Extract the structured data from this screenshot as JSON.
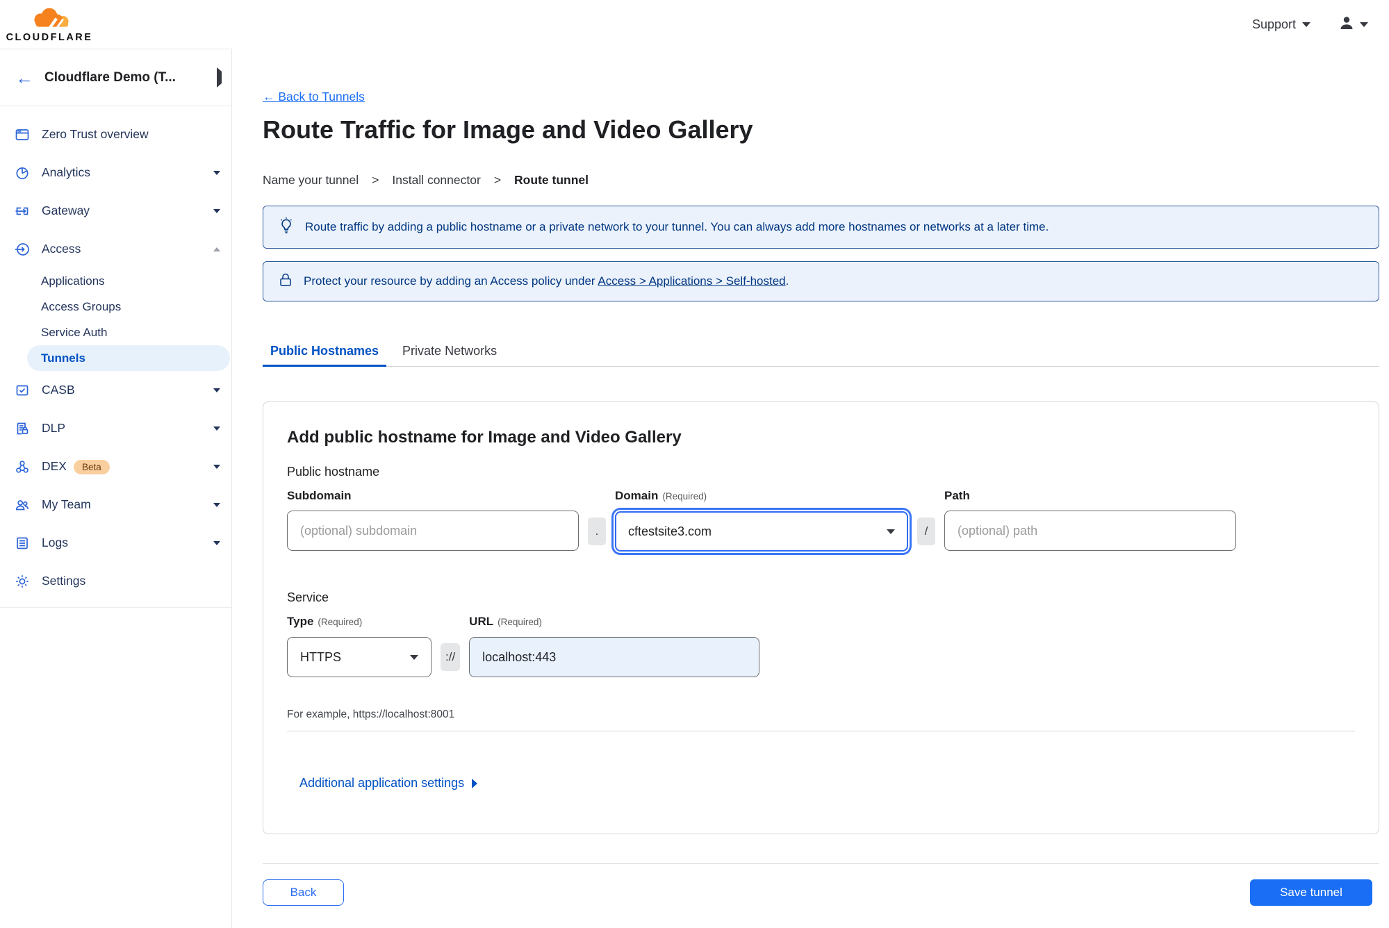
{
  "header": {
    "support": "Support"
  },
  "sidebar": {
    "account": "Cloudflare Demo (T...",
    "logo_word": "CLOUDFLARE",
    "items": {
      "zero_trust": "Zero Trust overview",
      "analytics": "Analytics",
      "gateway": "Gateway",
      "access": "Access",
      "casb": "CASB",
      "dlp": "DLP",
      "dex": "DEX",
      "dex_badge": "Beta",
      "my_team": "My Team",
      "logs": "Logs",
      "settings": "Settings"
    },
    "access_sub": {
      "applications": "Applications",
      "access_groups": "Access Groups",
      "service_auth": "Service Auth",
      "tunnels": "Tunnels"
    }
  },
  "main": {
    "back_link": "← Back to Tunnels",
    "title": "Route Traffic for Image and Video Gallery",
    "steps": {
      "s1": "Name your tunnel",
      "s2": "Install connector",
      "s3": "Route tunnel",
      "sep": ">"
    },
    "banner_tip": "Route traffic by adding a public hostname or a private network to your tunnel. You can always add more hostnames or networks at a later time.",
    "banner_lock": {
      "before": "Protect your resource by adding an Access policy under ",
      "link": "Access > Applications > Self-hosted",
      "after": "."
    },
    "tabs": {
      "public": "Public Hostnames",
      "private": "Private Networks"
    },
    "card": {
      "heading": "Add public hostname for Image and Video Gallery",
      "public_hostname_label": "Public hostname",
      "subdomain": {
        "label": "Subdomain",
        "placeholder": "(optional) subdomain"
      },
      "dot": ".",
      "domain": {
        "label": "Domain",
        "required": "(Required)",
        "value": "cftestsite3.com"
      },
      "slash": "/",
      "path": {
        "label": "Path",
        "placeholder": "(optional) path"
      },
      "service_label": "Service",
      "type": {
        "label": "Type",
        "required": "(Required)",
        "value": "HTTPS"
      },
      "scheme_sep": "://",
      "url": {
        "label": "URL",
        "required": "(Required)",
        "value": "localhost:443"
      },
      "example": "For example, https://localhost:8001",
      "additional": "Additional application settings"
    },
    "footer": {
      "back": "Back",
      "save": "Save tunnel"
    }
  },
  "colors": {
    "accent_blue": "#0051c3",
    "button_blue": "#1a6ef5",
    "link_blue": "#1b6ff5",
    "icon_blue": "#2b64d9",
    "nav_text": "#24355c",
    "banner_bg": "#EBF2FB",
    "banner_border": "#2f5a9e",
    "banner_text": "#003681",
    "selected_pill_bg": "#E7F1FB",
    "beta_badge_bg": "#FACFA0",
    "beta_badge_text": "#6b3a0f",
    "url_input_bg": "#E9F1FD",
    "logo_orange": "#F6821F",
    "logo_light_orange": "#FBAD41"
  }
}
